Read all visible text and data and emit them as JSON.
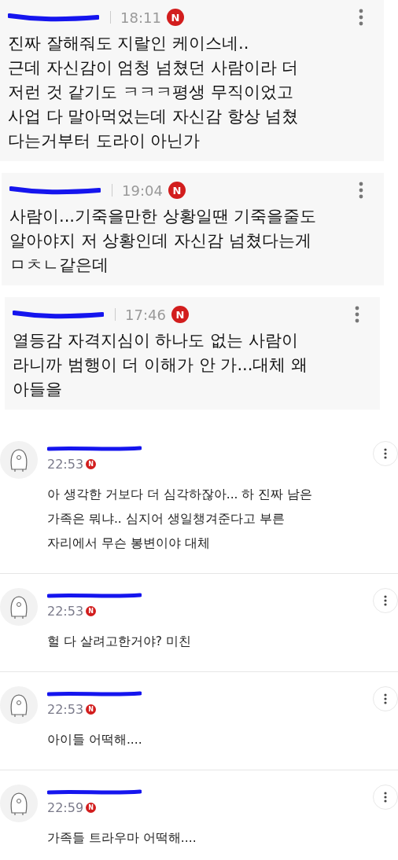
{
  "highlighted_comments": [
    {
      "time": "18:11",
      "badge": "N",
      "lines": [
        "진짜 잘해줘도 지랄인 케이스네..",
        "근데 자신감이 엄청 넘쳤던 사람이라 더",
        "저런 것 같기도 ㅋㅋㅋ평생 무직이었고",
        "사업 다 말아먹었는데 자신감 항상 넘쳤",
        "다는거부터 도라이 아닌가"
      ]
    },
    {
      "time": "19:04",
      "badge": "N",
      "lines": [
        "사람이...기죽을만한 상황일땐 기죽을줄도",
        "알아야지 저 상황인데 자신감 넘쳤다는게",
        "ㅁㅊㄴ같은데"
      ]
    },
    {
      "time": "17:46",
      "badge": "N",
      "lines": [
        "열등감 자격지심이 하나도 없는 사람이",
        "라니까 범행이 더 이해가 안 가...대체 왜",
        "아들을"
      ]
    }
  ],
  "comments": [
    {
      "time": "22:53",
      "badge": "N",
      "lines": [
        "아 생각한 거보다 더 심각하잖아... 하 진짜 남은",
        "가족은 뭐냐.. 심지어 생일챙겨준다고 부른",
        "자리에서 무슨 봉변이야 대체"
      ]
    },
    {
      "time": "22:53",
      "badge": "N",
      "lines": [
        "헐 다 살려고한거야? 미친"
      ]
    },
    {
      "time": "22:53",
      "badge": "N",
      "lines": [
        "아이들 어떡해...."
      ]
    },
    {
      "time": "22:59",
      "badge": "N",
      "lines": [
        "가족들 트라우마 어떡해...."
      ]
    }
  ]
}
